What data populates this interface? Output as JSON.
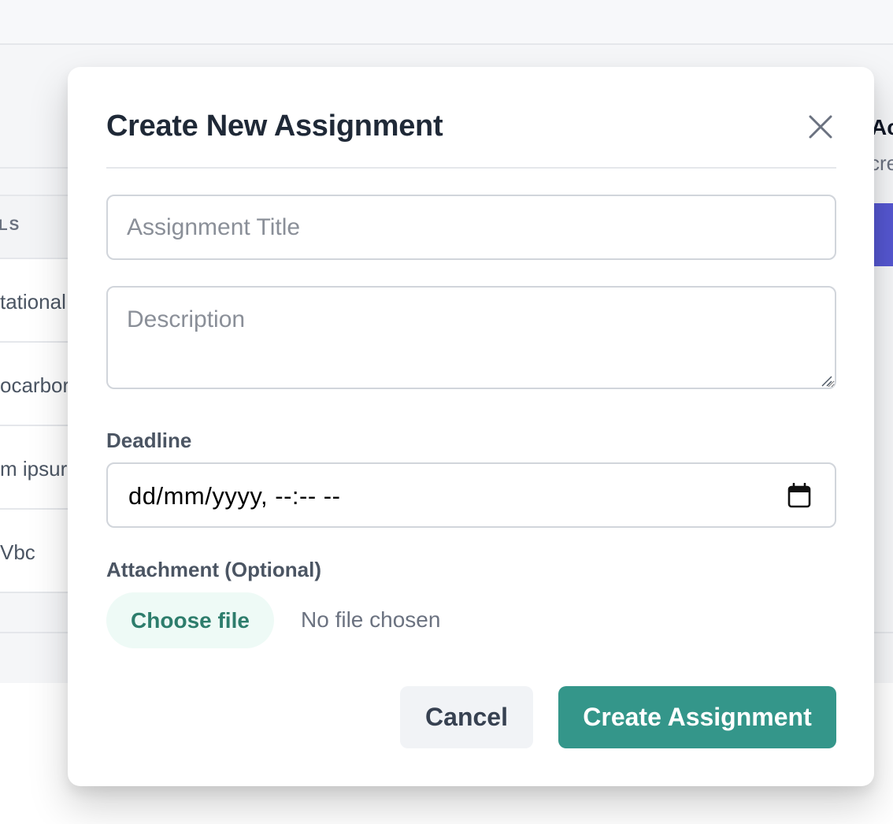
{
  "background": {
    "table_header_fragment": "LS",
    "row_fragments": [
      "tational",
      "ocarbor",
      "m ipsur",
      "Vbc"
    ],
    "right_heading_fragment": "Ac",
    "right_sub_fragment": "cre"
  },
  "modal": {
    "title": "Create New Assignment",
    "close_icon": "close-icon",
    "fields": {
      "title_placeholder": "Assignment Title",
      "description_placeholder": "Description",
      "deadline_label": "Deadline",
      "deadline_value": "dd/mm/yyyy, --:-- --",
      "attachment_label": "Attachment (Optional)",
      "choose_file_label": "Choose file",
      "file_status": "No file chosen"
    },
    "buttons": {
      "cancel": "Cancel",
      "create": "Create Assignment"
    }
  },
  "colors": {
    "primary": "#34968a",
    "primary_text": "#2d7d6c",
    "file_button_bg": "#eefaf6",
    "background_accent": "#5557d1"
  }
}
